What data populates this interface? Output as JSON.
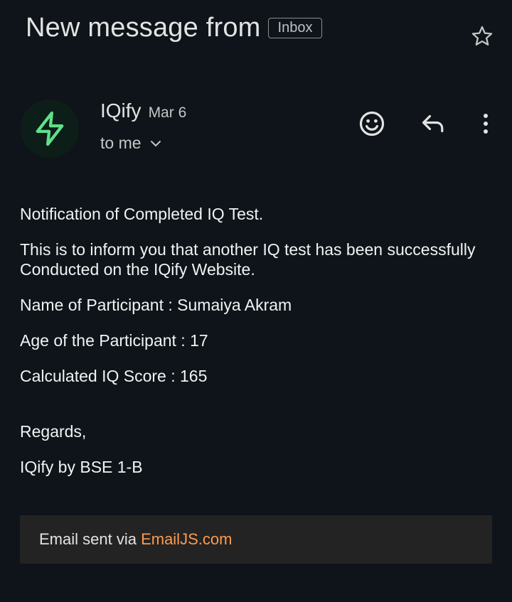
{
  "email": {
    "subject": "New message from",
    "label_badge": "Inbox",
    "sender": {
      "name": "IQify",
      "date": "Mar 6",
      "recipient_label": "to me",
      "avatar_icon": "lightning-bolt-icon",
      "avatar_icon_color": "#5fe08a"
    },
    "actions": {
      "star_icon": "star-icon",
      "emoji_icon": "smiley-icon",
      "reply_icon": "reply-icon",
      "more_icon": "more-vert-icon"
    },
    "body": {
      "heading": "Notification of Completed IQ Test.",
      "intro": "This is to inform you that another IQ test has been successfully Conducted on the IQify Website.",
      "participant_name": "Name of Participant :  Sumaiya Akram",
      "participant_age": "Age of the Participant : 17",
      "iq_score": "Calculated IQ Score : 165",
      "closing": "Regards,",
      "signature": "IQify by BSE 1-B"
    },
    "footer": {
      "prefix": "Email sent via ",
      "link_text": "EmailJS.com",
      "link_color": "#ff9a4d"
    }
  }
}
